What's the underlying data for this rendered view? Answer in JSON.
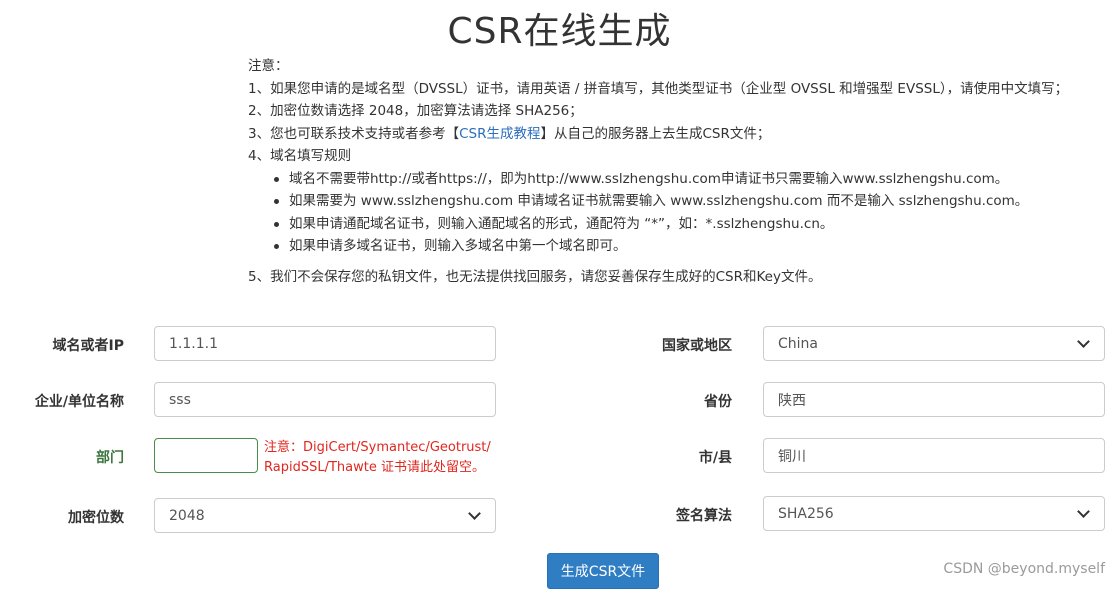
{
  "page": {
    "title": "CSR在线生成"
  },
  "notes": {
    "heading": "注意：",
    "item1": "1、如果您申请的是域名型（DVSSL）证书，请用英语 / 拼音填写，其他类型证书（企业型 OVSSL 和增强型 EVSSL），请使用中文填写；",
    "item2": "2、加密位数请选择 2048，加密算法请选择 SHA256；",
    "item3_prefix": "3、您也可联系技术支持或者参考【",
    "item3_link": "CSR生成教程",
    "item3_suffix": "】从自己的服务器上去生成CSR文件；",
    "item4": "4、域名填写规则",
    "rules": [
      "域名不需要带http://或者https://，即为http://www.sslzhengshu.com申请证书只需要输入www.sslzhengshu.com。",
      "如果需要为 www.sslzhengshu.com 申请域名证书就需要输入 www.sslzhengshu.com 而不是输入 sslzhengshu.com。",
      "如果申请通配域名证书，则输入通配域名的形式，通配符为 “*”，如：*.sslzhengshu.cn。",
      "如果申请多域名证书，则输入多域名中第一个域名即可。"
    ],
    "item5": "5、我们不会保存您的私钥文件，也无法提供找回服务，请您妥善保存生成好的CSR和Key文件。"
  },
  "form": {
    "domain": {
      "label": "域名或者IP",
      "value": "1.1.1.1"
    },
    "company": {
      "label": "企业/单位名称",
      "value": "sss"
    },
    "department": {
      "label": "部门",
      "value": ""
    },
    "key_bits": {
      "label": "加密位数",
      "value": "2048"
    },
    "country": {
      "label": "国家或地区",
      "value": "China"
    },
    "province": {
      "label": "省份",
      "value": "陕西"
    },
    "city": {
      "label": "市/县",
      "value": "铜川"
    },
    "sign_algo": {
      "label": "签名算法",
      "value": "SHA256"
    },
    "department_warning_line1": "注意：DigiCert/Symantec/Geotrust/",
    "department_warning_line2": "RapidSSL/Thawte 证书请此处留空。",
    "submit_label": "生成CSR文件"
  },
  "watermark": "CSDN @beyond.myself",
  "colors": {
    "accent": "#2f7ec4",
    "warning": "#e0271f",
    "success_label": "#3c763d",
    "link": "#2a6ebd"
  }
}
